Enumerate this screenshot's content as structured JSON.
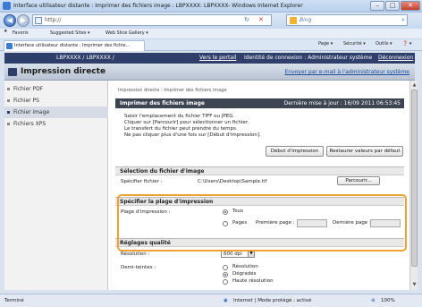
{
  "window": {
    "title": "Interface utilisateur distante : Imprimer des fichiers image : LBPXXXX: LBPXXXX- Windows Internet Explorer",
    "btn_min": "–",
    "btn_max": "□",
    "btn_close": "✕"
  },
  "browser": {
    "back_icon": "back-arrow-icon",
    "forward_icon": "forward-arrow-icon",
    "back_glyph": "◀",
    "forward_glyph": "▶",
    "address": "http://",
    "search_placeholder": "Bing",
    "refresh_glyph": "↻",
    "stop_glyph": "✕",
    "search_glyph": "⌕",
    "favorites_label": "Favoris",
    "suggested_sites": "Suggested Sites ▾",
    "web_slice": "Web Slice Gallery ▾",
    "tab_title": "Interface utilisateur distante : Imprimer des fichie...",
    "cmd_page": "Page ▾",
    "cmd_security": "Sécurité ▾",
    "cmd_tools": "Outils ▾",
    "cmd_help": "❓ ▾"
  },
  "header": {
    "device": "LBPXXXX / LBPXXXX /",
    "portal_link": "Vers le portail",
    "login_info": "Identité de connexion : Administrateur système",
    "logout_link": "Déconnexion",
    "app_title": "Impression directe",
    "send_link": "Envoyer par e-mail à l'administrateur système"
  },
  "sidebar": {
    "items": [
      {
        "label": "Fichier PDF"
      },
      {
        "label": "Fichier PS"
      },
      {
        "label": "Fichier image"
      },
      {
        "label": "Fichiers XPS"
      }
    ]
  },
  "main": {
    "breadcrumb": "Impression directe : Imprimer des fichiers image",
    "page_title": "Imprimer des fichiers image",
    "last_update": "Dernière mise à jour : 16/09 2011 06:53:45",
    "instructions": [
      "Saisir l'emplacement du fichier TIFF ou JPEG.",
      "Cliquer sur [Parcourir] pour sélectionner un fichier.",
      "Le transfert du fichier peut prendre du temps.",
      "Ne pas cliquer plus d'une fois sur [Début d'impression]."
    ],
    "start_print_button": "Début d'impression",
    "restore_defaults_button": "Restaurer valeurs par défaut",
    "file_section": {
      "title": "Sélection du fichier d'image",
      "label": "Spécifier fichier :",
      "value": "C:\\Users\\Desktop\\Sample.tif",
      "browse_button": "Parcourir..."
    },
    "range_section": {
      "title": "Spécifier la plage d'impression",
      "label": "Plage d'impression :",
      "option_all": "Tous",
      "option_pages": "Pages",
      "first_page_label": "Première page :",
      "last_page_label": "Dernière page :"
    },
    "quality_section": {
      "title": "Réglages qualité",
      "resolution_label": "Résolution :",
      "resolution_value": "600 dpi",
      "halftone_label": "Demi-teintes :",
      "halftone_options": [
        "Résolution",
        "Dégradés",
        "Haute résolution"
      ]
    }
  },
  "statusbar": {
    "left": "Terminé",
    "zone": "Internet | Mode protégé : activé",
    "zoom": "100%"
  }
}
